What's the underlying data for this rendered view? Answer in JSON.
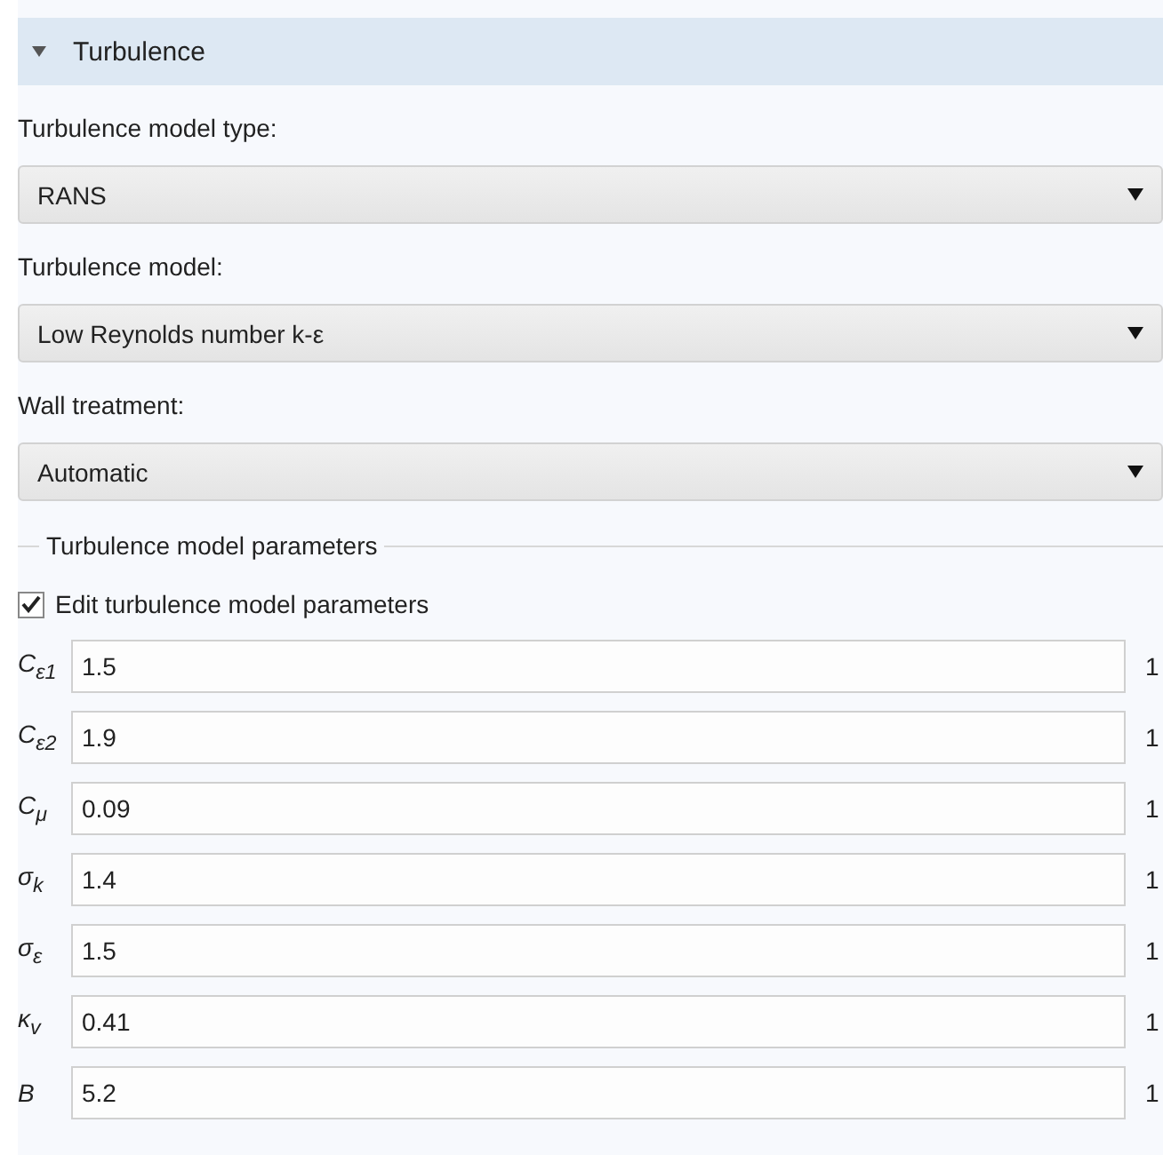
{
  "section": {
    "title": "Turbulence",
    "expanded": true
  },
  "selects": [
    {
      "label": "Turbulence model type:",
      "value": "RANS"
    },
    {
      "label": "Turbulence model:",
      "value": "Low Reynolds number k-ε"
    },
    {
      "label": "Wall treatment:",
      "value": "Automatic"
    }
  ],
  "group": {
    "title": "Turbulence model parameters",
    "checkbox": {
      "label": "Edit turbulence model parameters",
      "checked": true
    }
  },
  "parameters": [
    {
      "symbol": "C$_{ε1}$",
      "value": "1.5",
      "unit": "1"
    },
    {
      "symbol": "C$_{ε2}$",
      "value": "1.9",
      "unit": "1"
    },
    {
      "symbol": "C$_{μ}$",
      "value": "0.09",
      "unit": "1"
    },
    {
      "symbol": "σ$_{k}$",
      "value": "1.4",
      "unit": "1"
    },
    {
      "symbol": "σ$_{ε}$",
      "value": "1.5",
      "unit": "1"
    },
    {
      "symbol": "κ$_{v}$",
      "value": "0.41",
      "unit": "1"
    },
    {
      "symbol": "B",
      "value": "5.2",
      "unit": "1"
    }
  ]
}
